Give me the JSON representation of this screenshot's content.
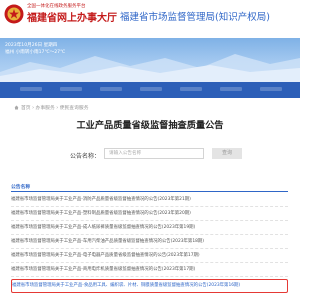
{
  "header": {
    "logo_tagline": "全国一体化在线政务服务平台",
    "logo_main": "福建省网上办事大厅",
    "department": "福建省市场监督管理局(知识产权局)"
  },
  "banner": {
    "date": "2023年10月26日 星期四",
    "weather": "福州 小雨转小雨17℃～27℃"
  },
  "breadcrumb": "首页 › 办事服务 › 便民查询服务",
  "page_title": "工业产品质量省级监督抽查质量公告",
  "search": {
    "label": "公告名称：",
    "placeholder": "请输入公告名称",
    "button": "查询"
  },
  "list": {
    "header": "公告名称",
    "items": [
      "福建省市场监督管理局关于工业产品-消防产品质量省级监督抽查情况的公告(2023年第21期)",
      "福建省市场监督管理局关于工业产品-塑料制品质量省级监督抽查情况的公告(2023年第20期)",
      "福建省市场监督管理局关于工业产品-成人纸尿裤质量省级监督抽查情况的公告(2023年第19期)",
      "福建省市场监督管理局关于工业产品-车用汽柴油产品质量省级监督抽查情况的公告(2023年第18期)",
      "福建省市场监督管理局关于工业产品-电子电器产品质量省级监督抽查情况的公告(2023年第17期)",
      "福建省市场监督管理局关于工业产品-商用电炸机质量省级监督抽查情况的公告(2023年第17期)",
      "福建省市场监督管理局关于工业产品-食品用工具、编织袋、片材、铜膜质量省级监督抽查情况的公告(2023年第16期)"
    ]
  },
  "colors": {
    "brand_red": "#c41a1a",
    "link_blue": "#2f66c7",
    "nav_blue": "#2c5fb8",
    "highlight_border": "#e53935"
  }
}
